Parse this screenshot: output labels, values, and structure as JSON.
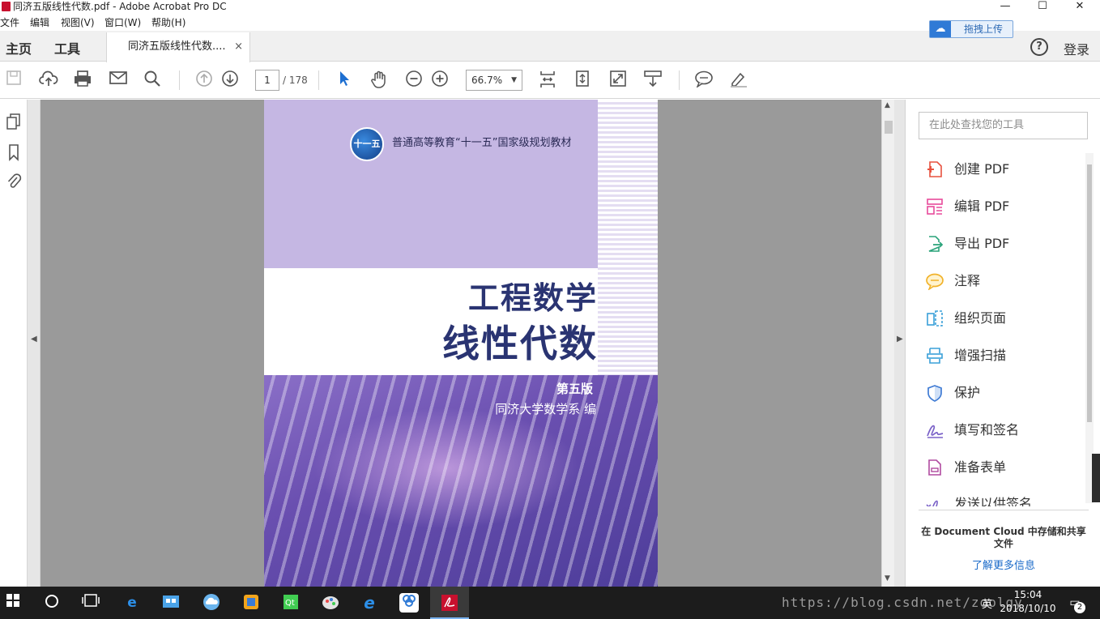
{
  "window": {
    "title": "同济五版线性代数.pdf - Adobe Acrobat Pro DC",
    "minimize": "—",
    "maximize": "☐",
    "close": "✕"
  },
  "menu": [
    "文件",
    "编辑",
    "视图(V)",
    "窗口(W)",
    "帮助(H)"
  ],
  "nav": {
    "home": "主页",
    "tools": "工具",
    "doc_tab": "同济五版线性代数....",
    "tab_close": "×",
    "upload": "拖拽上传",
    "help": "?",
    "login": "登录"
  },
  "toolbar": {
    "page_current": "1",
    "page_total": "/ 178",
    "zoom": "66.7%"
  },
  "document": {
    "series": "普通高等教育“十一五”国家级规划教材",
    "logo_text": "十一五",
    "title_line1": "工程数学",
    "title_line2": "线性代数",
    "edition": "第五版",
    "author": "同济大学数学系  编"
  },
  "tools_pane": {
    "search_placeholder": "在此处查找您的工具",
    "items": [
      {
        "label": "创建 PDF",
        "icon": "create-pdf-icon",
        "color": "#e8523f"
      },
      {
        "label": "编辑 PDF",
        "icon": "edit-pdf-icon",
        "color": "#e84a9b"
      },
      {
        "label": "导出 PDF",
        "icon": "export-pdf-icon",
        "color": "#2aa37a"
      },
      {
        "label": "注释",
        "icon": "comment-icon",
        "color": "#f1b22a"
      },
      {
        "label": "组织页面",
        "icon": "organize-pages-icon",
        "color": "#3aa0d8"
      },
      {
        "label": "增强扫描",
        "icon": "enhance-scan-icon",
        "color": "#3aa0d8"
      },
      {
        "label": "保护",
        "icon": "protect-icon",
        "color": "#3f7bd4"
      },
      {
        "label": "填写和签名",
        "icon": "fill-sign-icon",
        "color": "#7b62c8"
      },
      {
        "label": "准备表单",
        "icon": "prepare-form-icon",
        "color": "#b04aa0"
      },
      {
        "label": "发送以供签名",
        "icon": "send-sign-icon",
        "color": "#7b62c8"
      }
    ],
    "cloud_message": "在 Document Cloud 中存储和共享文件",
    "learn_more": "了解更多信息"
  },
  "taskbar": {
    "watermark": "https://blog.csdn.net/zoolgy",
    "ime": "英",
    "time": "15:04",
    "date": "2018/10/10",
    "notifications": "2"
  }
}
